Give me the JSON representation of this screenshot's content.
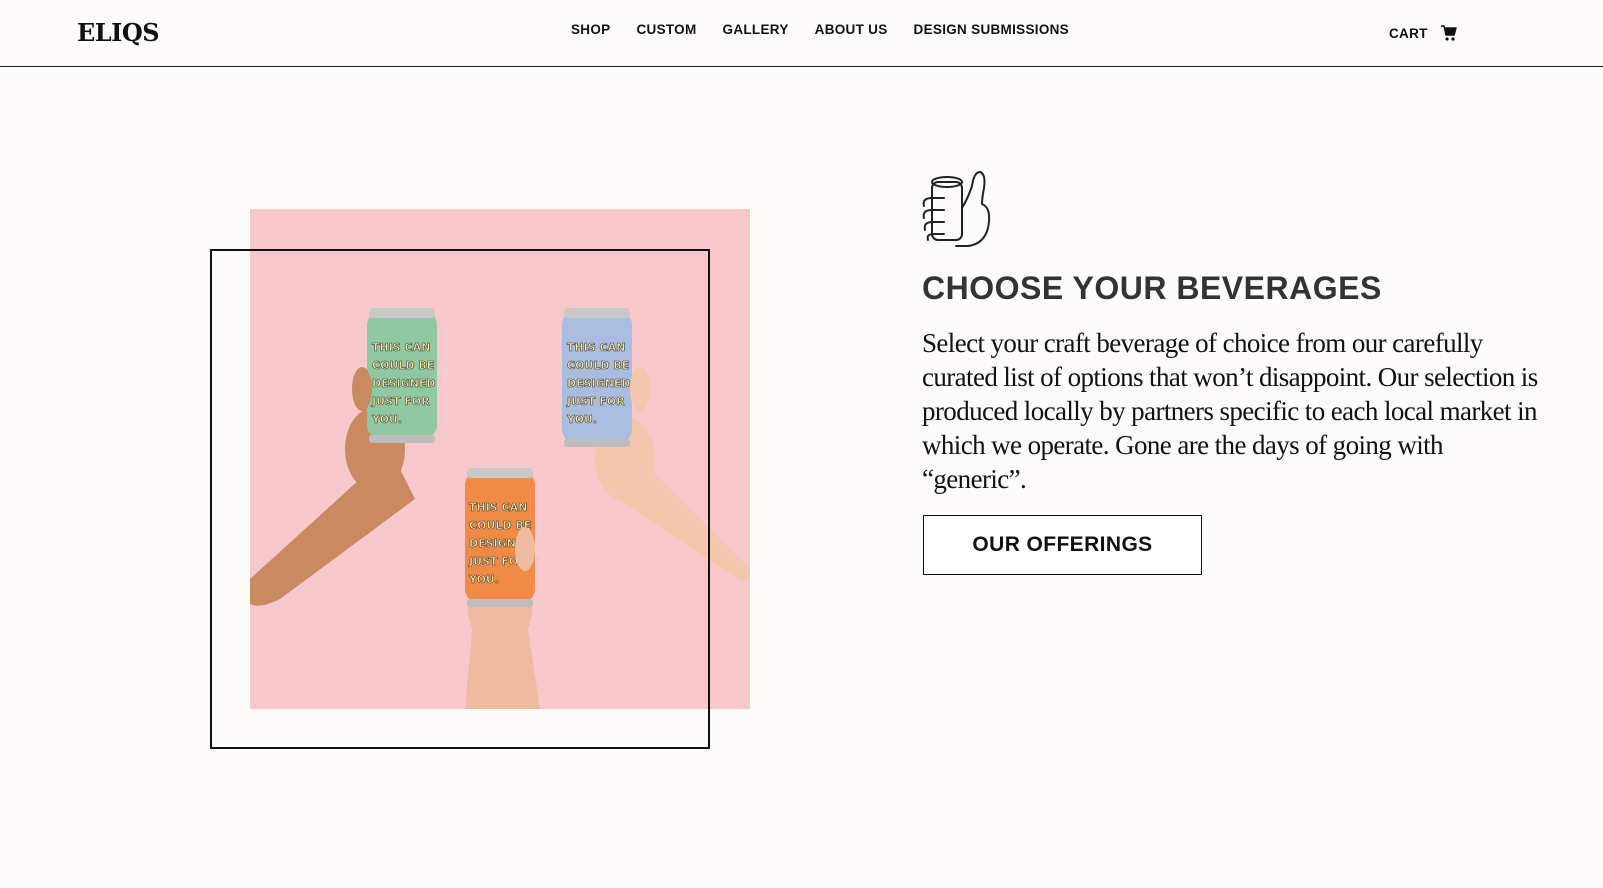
{
  "brand": {
    "logo_text": "ELIQS"
  },
  "nav": {
    "items": [
      {
        "label": "SHOP"
      },
      {
        "label": "CUSTOM"
      },
      {
        "label": "GALLERY"
      },
      {
        "label": "ABOUT US"
      },
      {
        "label": "DESIGN SUBMISSIONS"
      }
    ]
  },
  "cart": {
    "label": "CART",
    "icon": "cart-icon"
  },
  "hero": {
    "photo": {
      "background_color": "#f9c8cd",
      "can_text": [
        "THIS CAN",
        "COULD BE",
        "DESIGNED",
        "JUST FOR",
        "YOU."
      ],
      "cans": [
        {
          "color": "#8fc9a4"
        },
        {
          "color": "#a9bde0"
        },
        {
          "color": "#f08a45"
        }
      ]
    }
  },
  "feature": {
    "icon": "thumbs-up-can-icon",
    "heading": "CHOOSE YOUR BEVERAGES",
    "body": "Select your craft beverage of choice from our carefully curated list of options that won’t disappoint. Our selection is produced locally by partners specific to each local market in which we operate. Gone are the days of going with “generic”.",
    "cta_label": "OUR OFFERINGS"
  }
}
